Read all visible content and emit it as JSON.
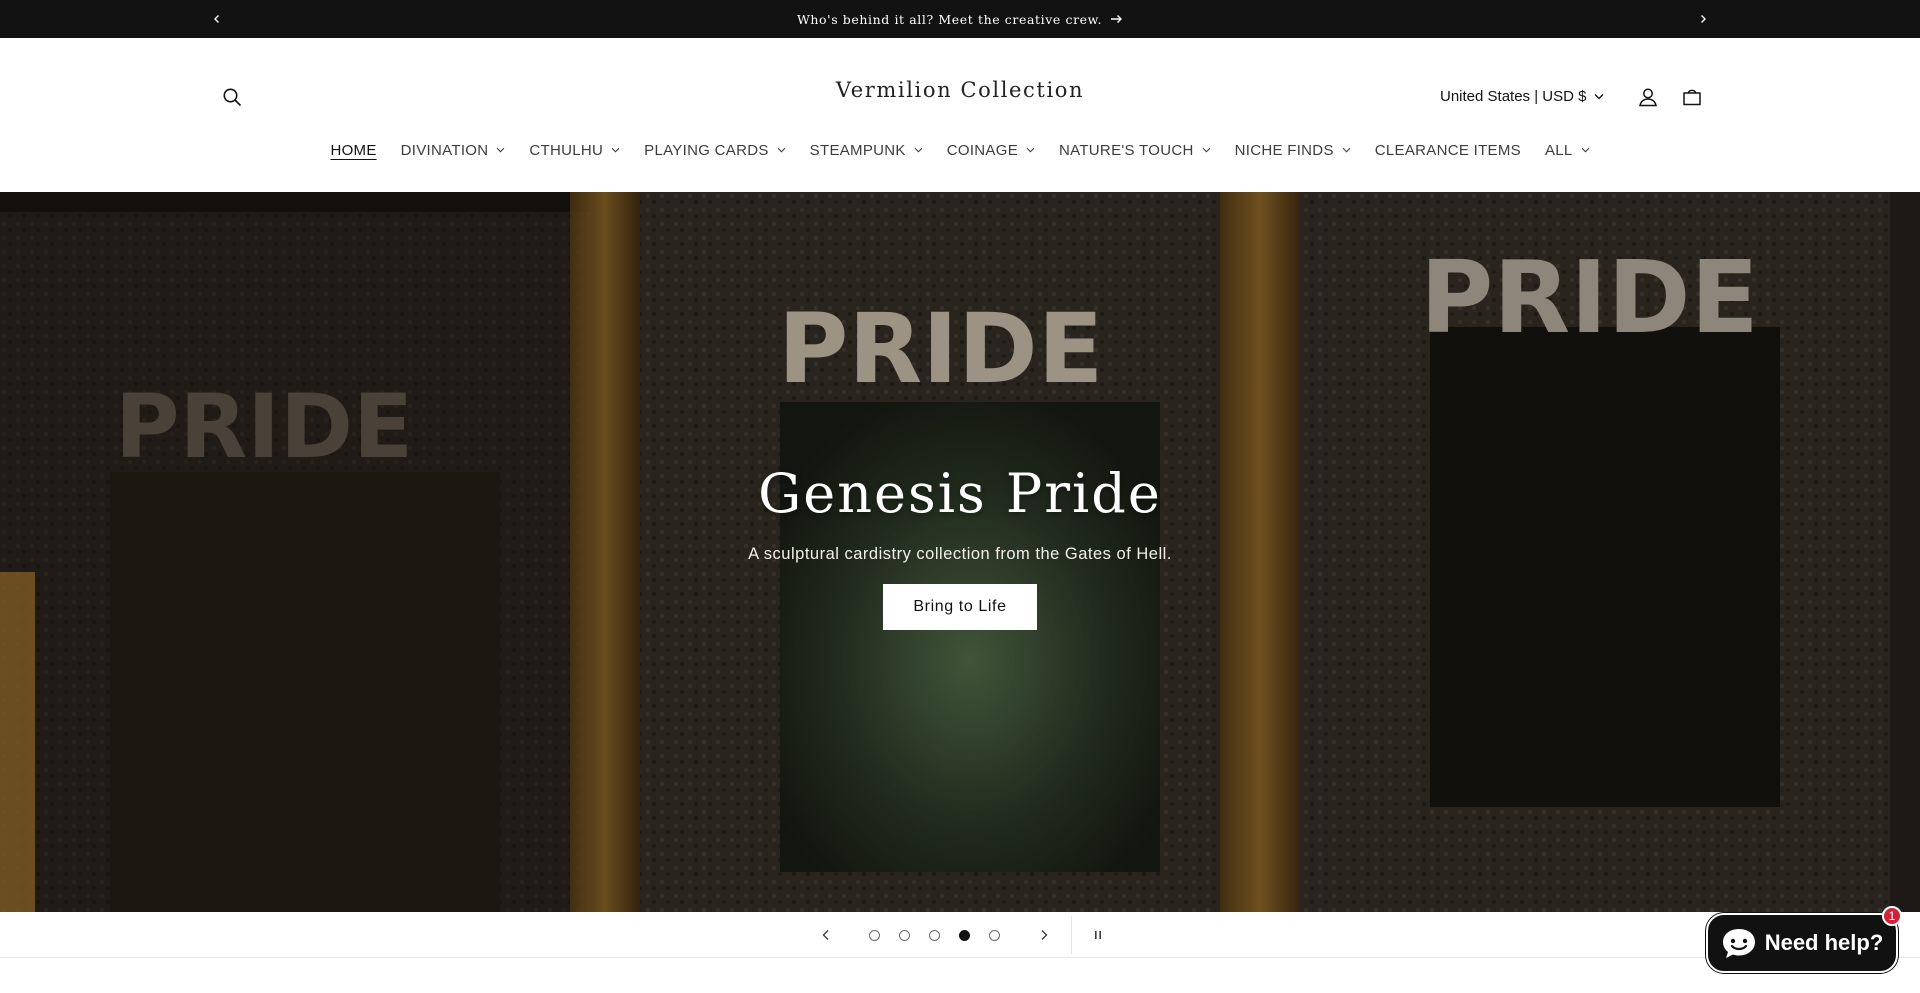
{
  "announcement": {
    "text": "Who's behind it all? Meet the creative crew.",
    "prev_icon": "chevron-left-icon",
    "next_icon": "chevron-right-icon"
  },
  "header": {
    "logo": "Vermilion Collection",
    "country_selector": "United States | USD $",
    "icons": [
      "search-icon",
      "account-icon",
      "cart-icon"
    ]
  },
  "nav": {
    "items": [
      {
        "label": "HOME",
        "active": true,
        "dropdown": false
      },
      {
        "label": "DIVINATION",
        "dropdown": true
      },
      {
        "label": "CTHULHU",
        "dropdown": true
      },
      {
        "label": "PLAYING CARDS",
        "dropdown": true
      },
      {
        "label": "STEAMPUNK",
        "dropdown": true
      },
      {
        "label": "COINAGE",
        "dropdown": true
      },
      {
        "label": "NATURE'S TOUCH",
        "dropdown": true
      },
      {
        "label": "NICHE FINDS",
        "dropdown": true
      },
      {
        "label": "CLEARANCE ITEMS",
        "dropdown": false
      },
      {
        "label": "ALL",
        "dropdown": true
      }
    ]
  },
  "hero": {
    "title": "Genesis Pride",
    "subtitle": "A sculptural cardistry collection from the Gates of Hell.",
    "button_label": "Bring to Life",
    "image_text": "PRIDE"
  },
  "slider": {
    "slide_count": 5,
    "active_slide": 4,
    "icons": [
      "chevron-left-icon",
      "chevron-right-icon",
      "pause-icon"
    ]
  },
  "chat": {
    "label": "Need help?",
    "badge": "1"
  },
  "colors": {
    "announcement_bg": "#121212",
    "chat_bg": "#111111",
    "badge": "#d0213a"
  }
}
